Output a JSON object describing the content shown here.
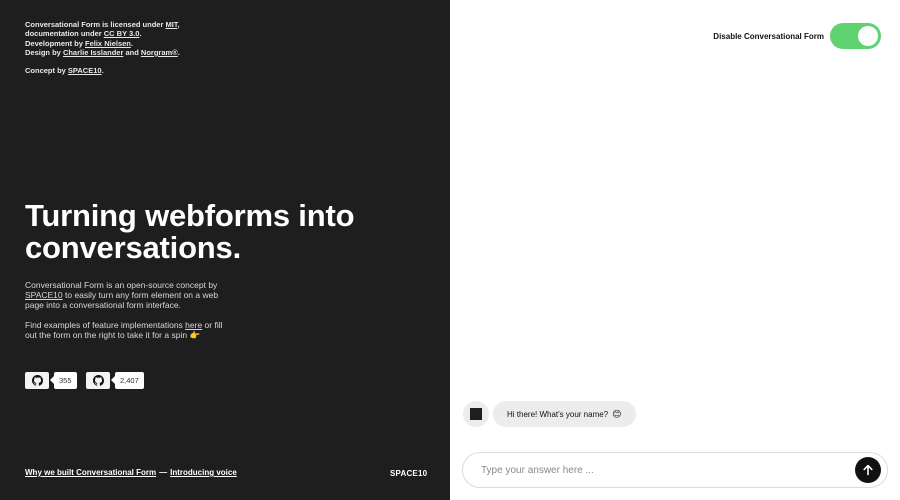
{
  "credits": {
    "line1_pre": "Conversational Form is licensed under ",
    "line1_link": "MIT",
    "line1_post": ",",
    "line2_pre": "documentation under ",
    "line2_link": "CC BY 3.0",
    "line2_post": ".",
    "line3_pre": "Development by ",
    "line3_link": "Felix Nielsen",
    "line3_post": ".",
    "line4_pre": "Design by ",
    "line4_link1": "Charlie Isslander",
    "line4_mid": " and ",
    "line4_link2": "Norgram®",
    "line4_post": ".",
    "concept_pre": "Concept by ",
    "concept_link": "SPACE10",
    "concept_post": "."
  },
  "hero": {
    "line1": "Turning webforms into",
    "line2": "conversations."
  },
  "intro": {
    "p1_pre": "Conversational Form is an open-source concept by ",
    "p1_link": "SPACE10",
    "p1_post": " to easily turn any form element on a web page into a conversational form interface.",
    "p2_pre": "Find examples of feature implementations ",
    "p2_link": "here",
    "p2_post": " or fill out the form on the right to take it for a spin",
    "p2_emoji": "👉"
  },
  "github": {
    "buttons": [
      {
        "icon": "github-icon",
        "count": "355"
      },
      {
        "icon": "github-icon",
        "count": "2,407"
      }
    ]
  },
  "footer": {
    "link1": "Why we built Conversational Form",
    "separator": "—",
    "link2": "Introducing voice",
    "brand": "SPACE10"
  },
  "toggle": {
    "label": "Disable Conversational Form",
    "state": "on",
    "color": "#5fd36f"
  },
  "chat": {
    "bot_message": "Hi there! What's your name?",
    "bot_emoji": "😊",
    "input_placeholder": "Type your answer here ...",
    "send_icon": "arrow-up-icon"
  }
}
